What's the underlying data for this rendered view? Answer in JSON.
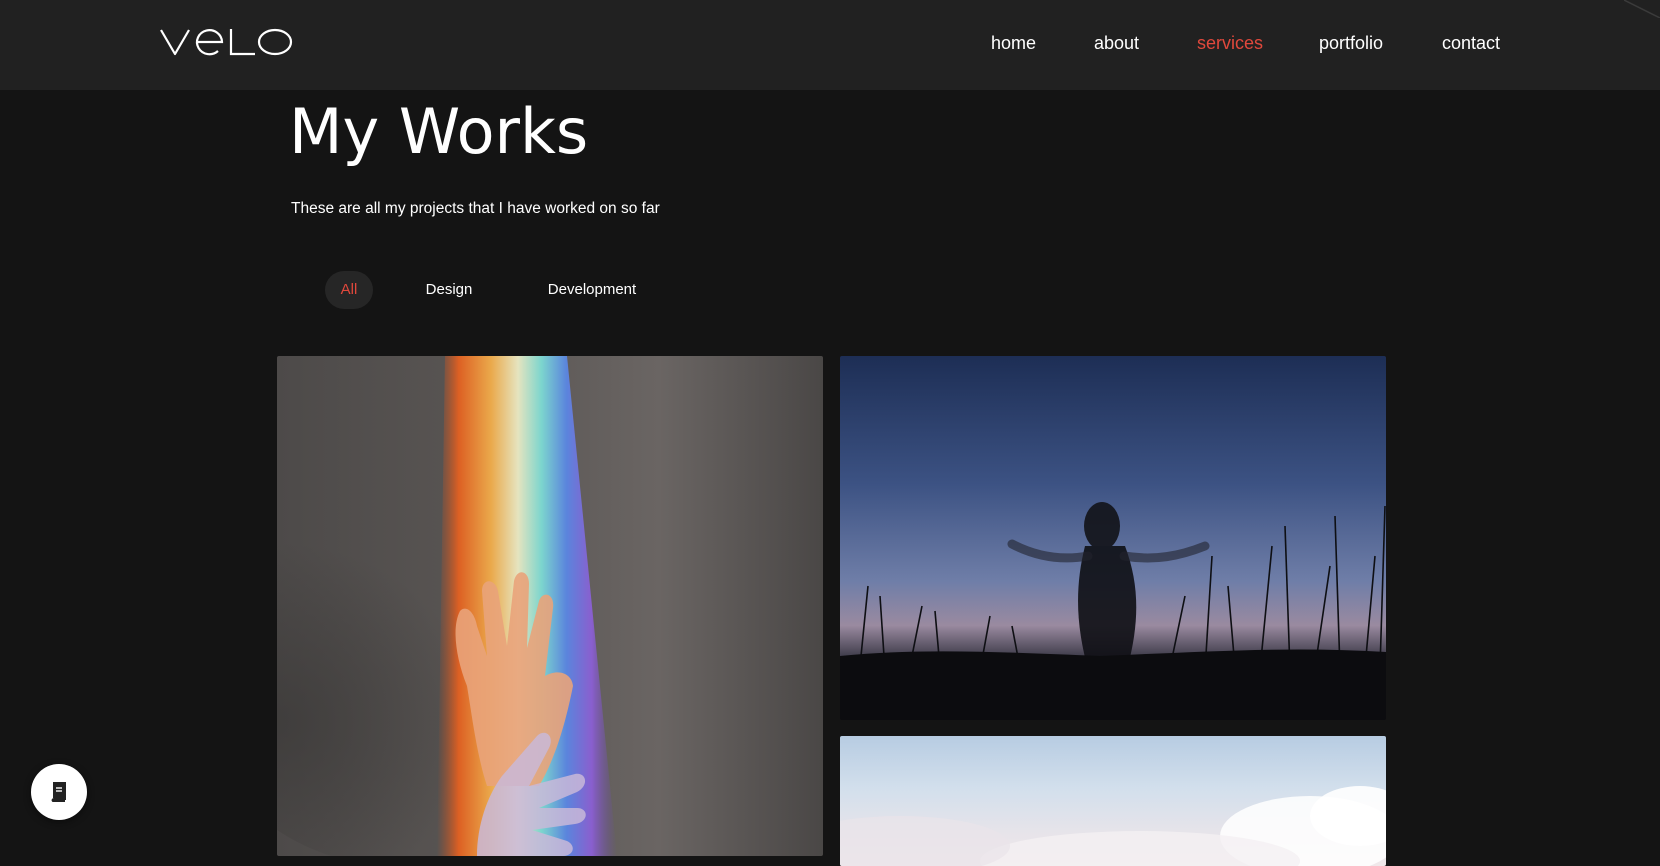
{
  "header": {
    "logo_text": "VELO",
    "nav": [
      {
        "label": "home",
        "active": false
      },
      {
        "label": "about",
        "active": false
      },
      {
        "label": "services",
        "active": true
      },
      {
        "label": "portfolio",
        "active": false
      },
      {
        "label": "contact",
        "active": false
      }
    ]
  },
  "main": {
    "title": "My Works",
    "subtitle": "These are all my projects that I have worked on so far",
    "filters": [
      {
        "label": "All",
        "active": true
      },
      {
        "label": "Design",
        "active": false
      },
      {
        "label": "Development",
        "active": false
      }
    ]
  },
  "gallery": [
    {
      "name": "rainbow-hands-image"
    },
    {
      "name": "sky-silhouette-image"
    },
    {
      "name": "clouds-image"
    }
  ],
  "fab": {
    "icon": "book-icon"
  },
  "colors": {
    "background": "#141414",
    "header": "#212121",
    "accent": "#e0483c",
    "text": "#ffffff"
  }
}
